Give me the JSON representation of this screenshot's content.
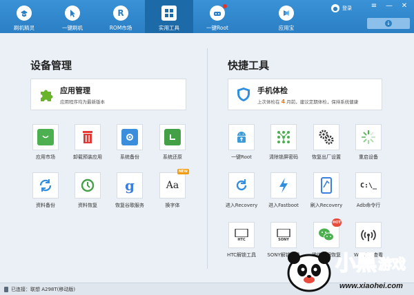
{
  "nav": [
    {
      "label": "刷机精灵",
      "icon": "logo-icon"
    },
    {
      "label": "一键刷机",
      "icon": "cursor-icon"
    },
    {
      "label": "ROM市场",
      "icon": "rom-icon"
    },
    {
      "label": "实用工具",
      "icon": "grid-icon",
      "active": true
    },
    {
      "label": "一键Root",
      "icon": "root-icon"
    },
    {
      "label": "应用宝",
      "icon": "appstore-icon"
    }
  ],
  "header": {
    "login_label": "登录",
    "menu_glyph": "≡",
    "minimize_glyph": "—",
    "close_glyph": "✕",
    "download_glyph": "↓"
  },
  "left": {
    "title": "设备管理",
    "card": {
      "title": "应用管理",
      "sub": "应用程序均为最新版本"
    },
    "tools": [
      {
        "label": "应用市场",
        "icon": "shopping-bag-icon",
        "color": "#4caf50"
      },
      {
        "label": "卸载预装应用",
        "icon": "trash-icon",
        "color": "#e53935"
      },
      {
        "label": "系统备份",
        "icon": "system-backup-icon",
        "color": "#3b8edc"
      },
      {
        "label": "系统还原",
        "icon": "system-restore-icon",
        "color": "#43a047"
      },
      {
        "label": "资料备份",
        "icon": "sync-icon",
        "color": "#2f8ee0"
      },
      {
        "label": "资料恢复",
        "icon": "clock-restore-icon",
        "color": "#43a047"
      },
      {
        "label": "恢复谷歌服务",
        "icon": "google-icon",
        "color": "#3b7fe0",
        "glyph": "g"
      },
      {
        "label": "换字体",
        "icon": "font-icon",
        "color": "#222222",
        "glyph": "Aa",
        "badge": "NEW"
      }
    ]
  },
  "right": {
    "title": "快捷工具",
    "card": {
      "title": "手机体检",
      "sub_prefix": "上次体检在",
      "sub_days": "4",
      "sub_suffix": "月前，建议定期体检，保持系统健康"
    },
    "tools": [
      {
        "label": "一键Root",
        "icon": "android-root-icon",
        "color": "#3a9bd8"
      },
      {
        "label": "清除锁屏密码",
        "icon": "pattern-lock-icon",
        "color": "#4caf50"
      },
      {
        "label": "恢复出厂设置",
        "icon": "gears-icon",
        "color": "#333333"
      },
      {
        "label": "重启设备",
        "icon": "loading-icon",
        "color": "#4caf50"
      },
      {
        "label": "进入Recovery",
        "icon": "refresh-icon",
        "color": "#2f8ee0"
      },
      {
        "label": "进入Fastboot",
        "icon": "lightning-icon",
        "color": "#2f8ee0"
      },
      {
        "label": "刷入Recovery",
        "icon": "tablet-icon",
        "color": "#3b7fe0"
      },
      {
        "label": "Adb命令行",
        "icon": "terminal-icon",
        "color": "#222222",
        "glyph": "C:\\_"
      },
      {
        "label": "HTC解锁工具",
        "icon": "htc-phone-icon",
        "color": "#333333",
        "glyph": "HTC"
      },
      {
        "label": "SONY解锁工具",
        "icon": "sony-phone-icon",
        "color": "#333333",
        "glyph": "SONY"
      },
      {
        "label": "微信数据恢复",
        "icon": "wechat-icon",
        "color": "#4caf50",
        "badge": "HOT"
      },
      {
        "label": "WiFi密码查看",
        "icon": "wifi-icon",
        "color": "#333333"
      }
    ]
  },
  "status": {
    "text": "已连接：联想 A298T(移动版)"
  },
  "watermark": {
    "brand": "小黑游戏",
    "url": "www.xiaohei.com"
  }
}
